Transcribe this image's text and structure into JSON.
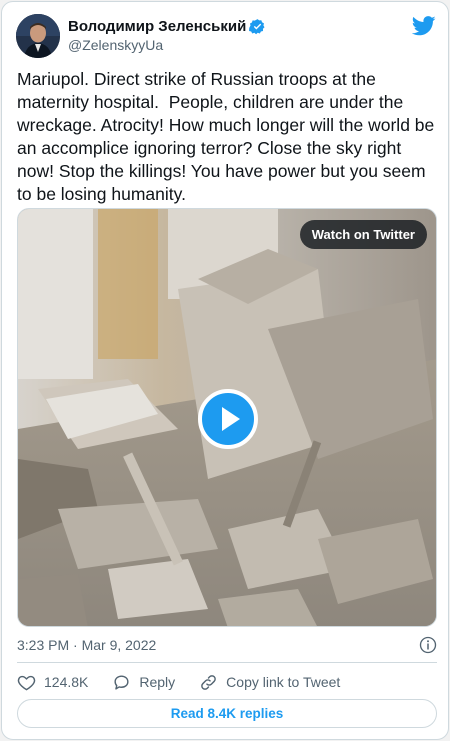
{
  "author": {
    "display_name": "Володимир Зеленський",
    "handle": "@ZelenskyyUa"
  },
  "icons": {
    "verified": "verified-badge-icon",
    "logo": "twitter-bird-icon",
    "info": "info-icon",
    "like": "heart-icon",
    "reply": "reply-bubble-icon",
    "copy_link": "link-icon",
    "play": "play-icon"
  },
  "tweet": {
    "text": "Mariupol. Direct strike of Russian troops at the maternity hospital.  People, children are under the wreckage. Atrocity! How much longer will the world be an accomplice ignoring terror? Close the sky right now! Stop the killings! You have power but you seem to be losing humanity."
  },
  "media": {
    "watch_label": "Watch on Twitter"
  },
  "meta": {
    "timestamp": "3:23 PM · Mar 9, 2022"
  },
  "actions": {
    "like_count": "124.8K",
    "reply_label": "Reply",
    "copy_label": "Copy link to Tweet"
  },
  "replies": {
    "label": "Read 8.4K replies"
  },
  "colors": {
    "accent": "#1d9bf0",
    "text": "#0f1419",
    "secondary": "#536471",
    "border": "#cfd9de"
  }
}
